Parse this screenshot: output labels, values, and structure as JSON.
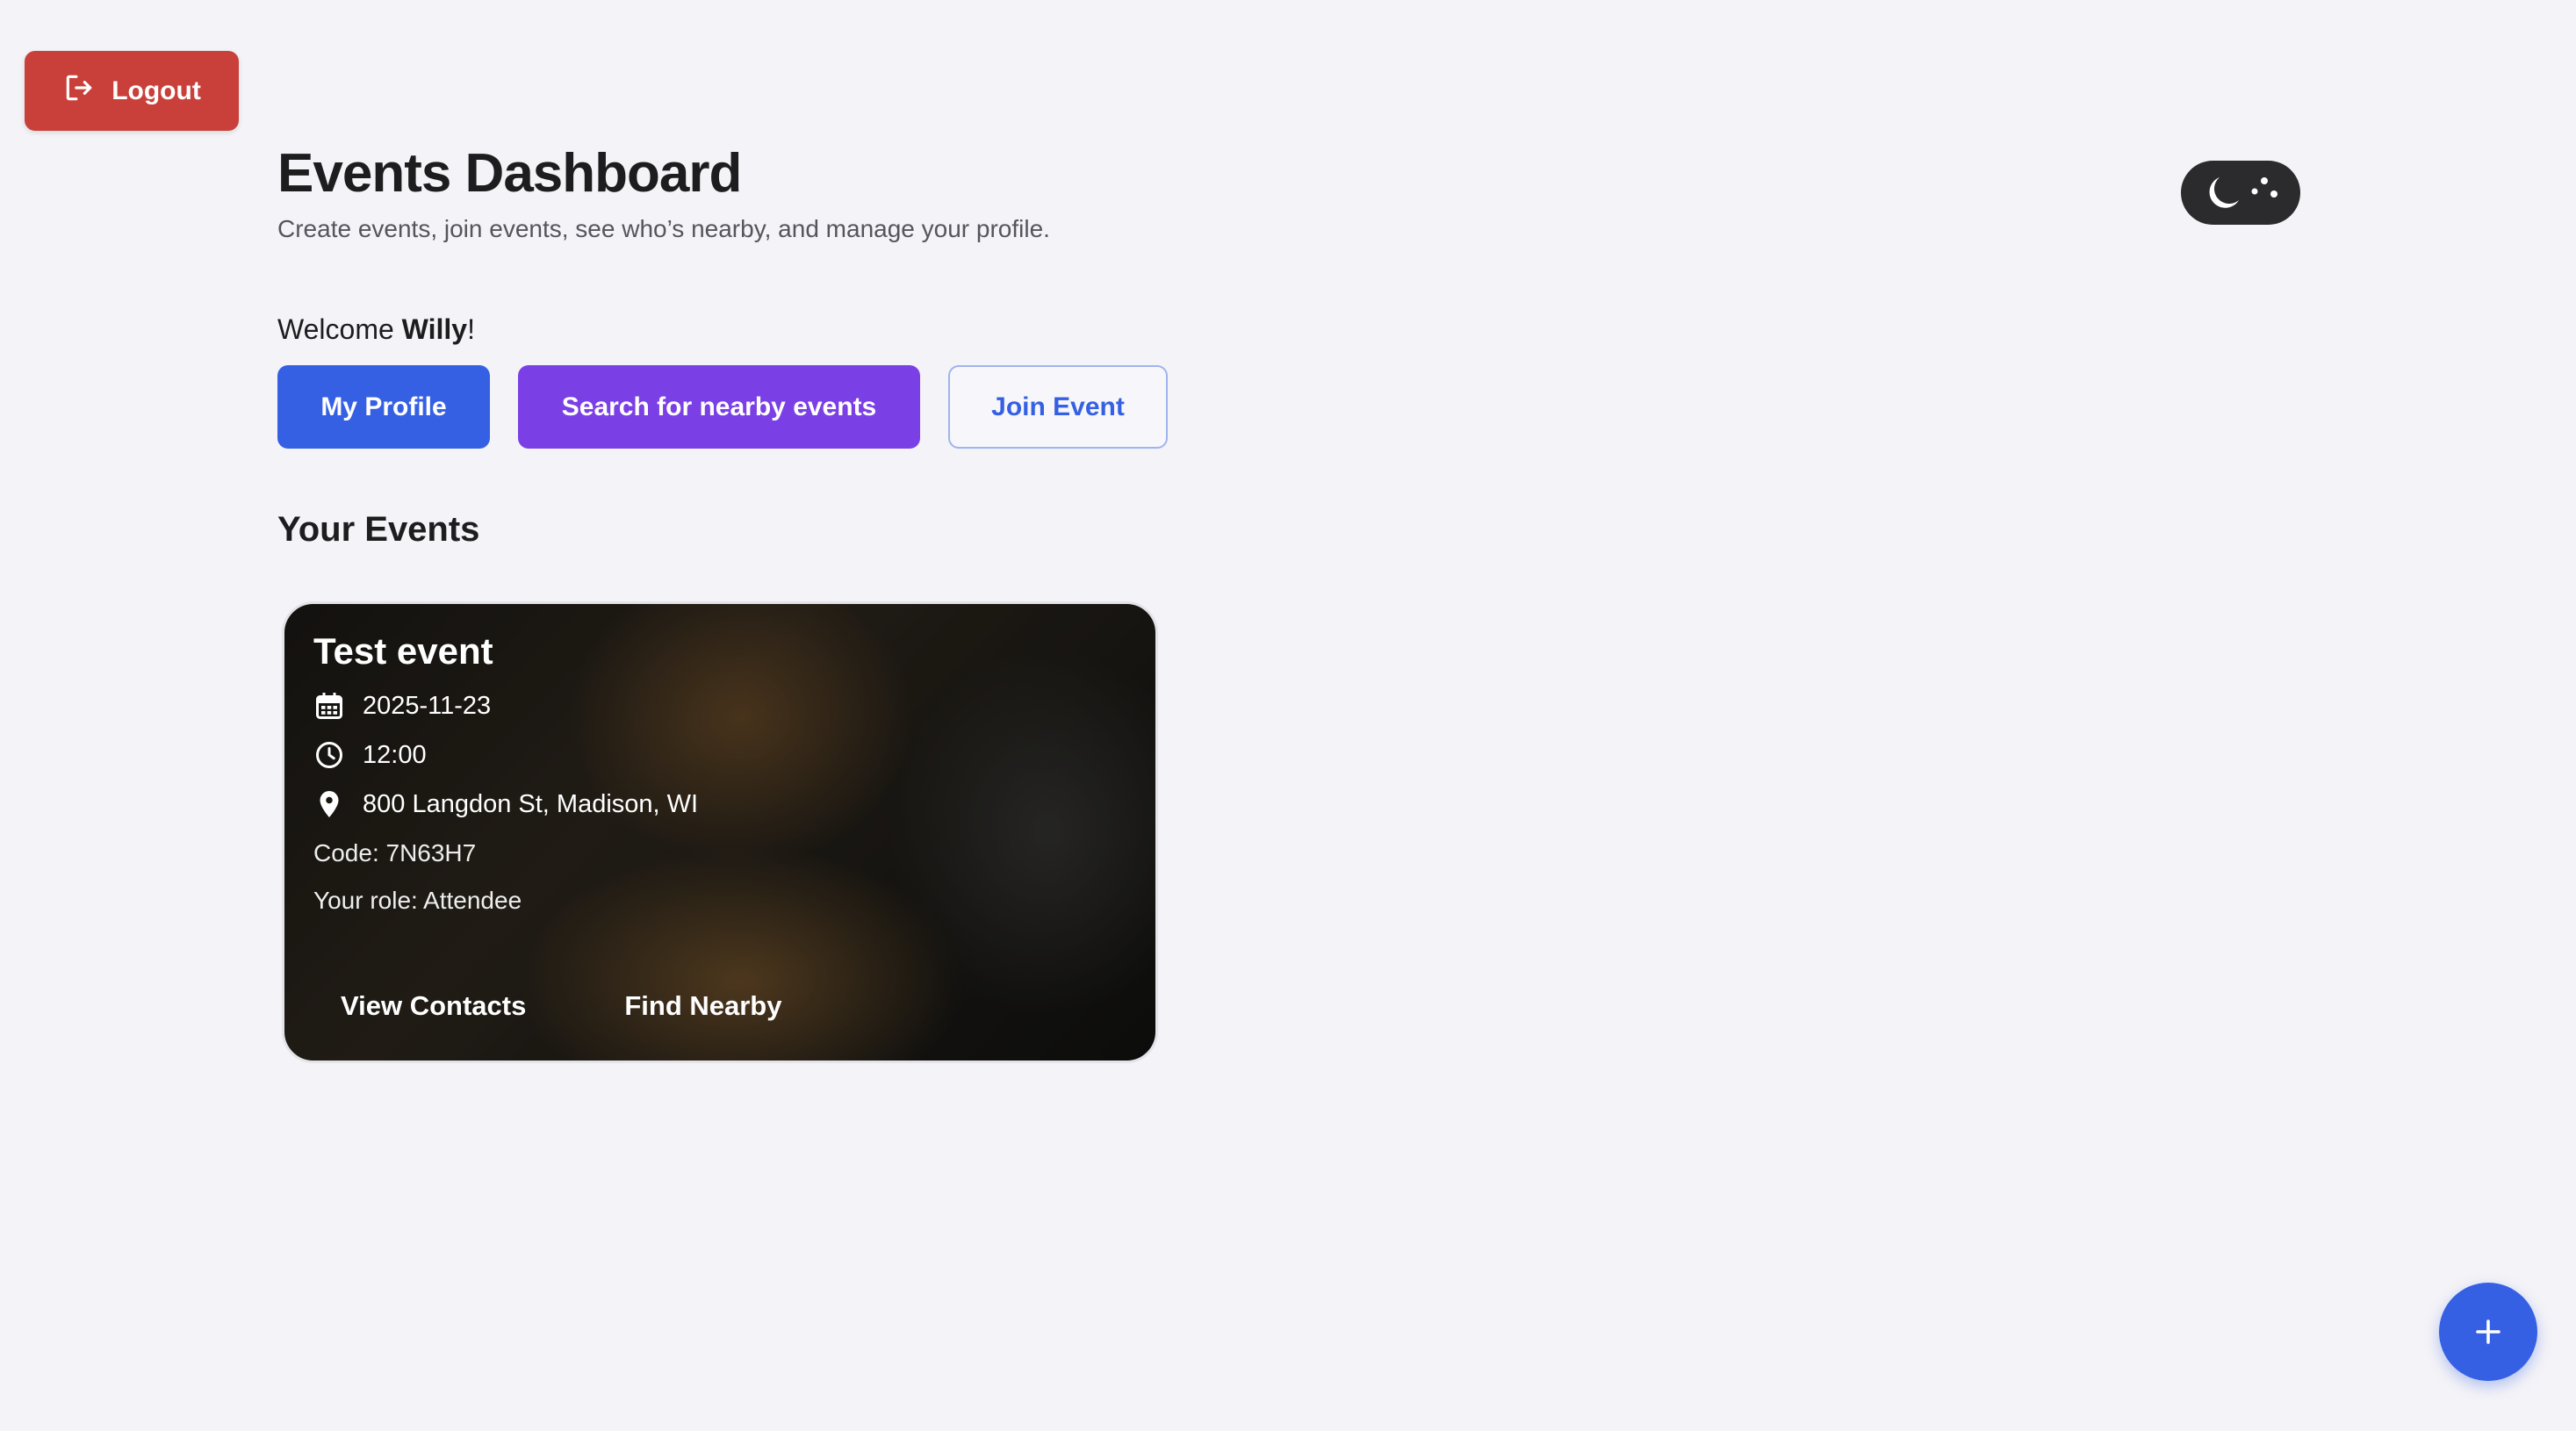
{
  "header": {
    "logout_label": "Logout",
    "title": "Events Dashboard",
    "subtitle": "Create events, join events, see who’s nearby, and manage your profile."
  },
  "welcome": {
    "prefix": "Welcome ",
    "name": "Willy",
    "suffix": "!"
  },
  "actions": {
    "profile": "My Profile",
    "search": "Search for nearby events",
    "join": "Join Event"
  },
  "events_section": {
    "title": "Your Events",
    "events": [
      {
        "title": "Test event",
        "date": "2025-11-23",
        "time": "12:00",
        "location": "800 Langdon St, Madison, WI",
        "code": "Code: 7N63H7",
        "role": "Your role: Attendee",
        "view_contacts": "View Contacts",
        "find_nearby": "Find Nearby"
      }
    ]
  },
  "icons": {
    "logout": "logout-icon",
    "theme": "moon-icon",
    "calendar": "calendar-icon",
    "clock": "clock-icon",
    "location": "location-pin-icon",
    "fab": "plus-icon"
  },
  "colors": {
    "logout": "#c9403a",
    "primary": "#3560e4",
    "secondary": "#7b3fe6",
    "background": "#f4f3f7"
  }
}
